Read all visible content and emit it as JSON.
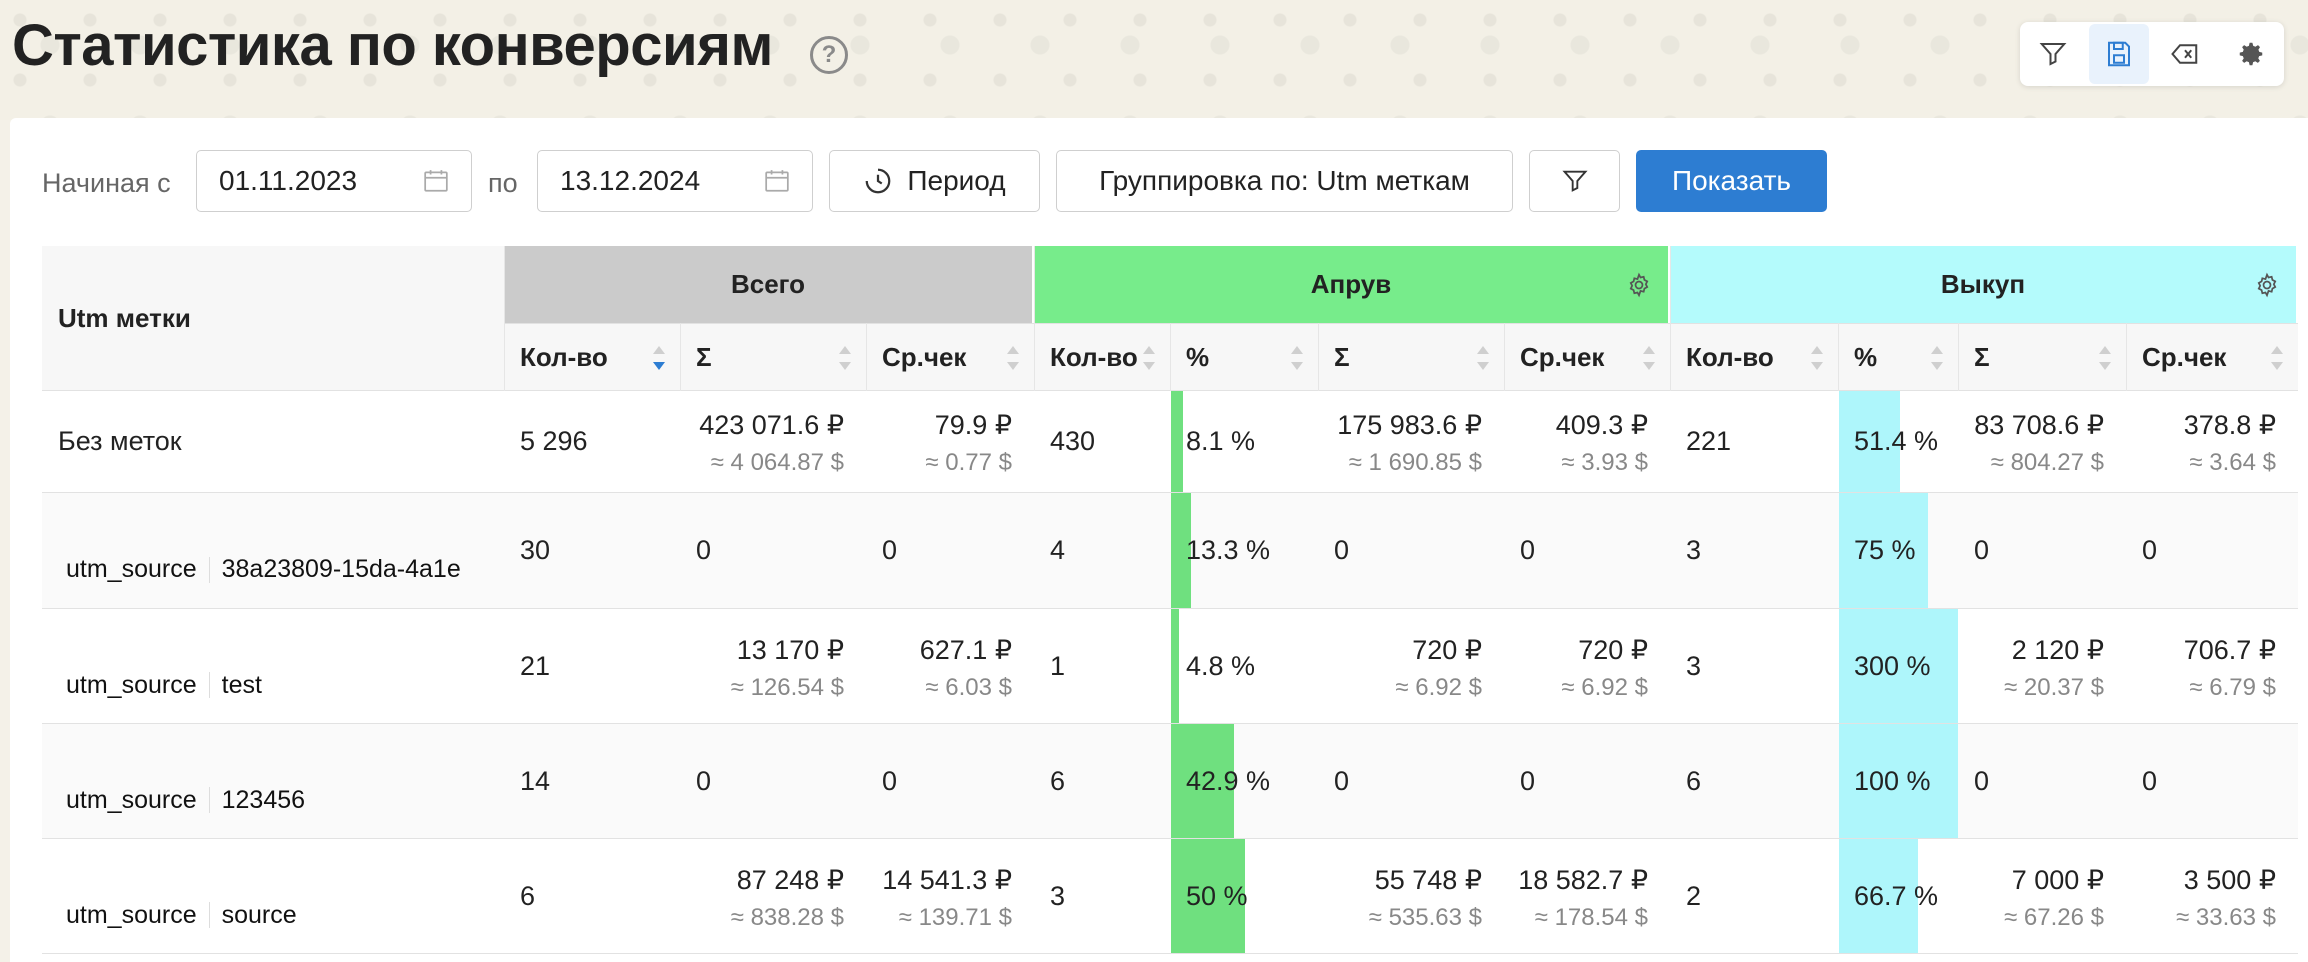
{
  "page": {
    "title": "Статистика по конверсиям"
  },
  "filters": {
    "from_label": "Начиная с",
    "from_date": "01.11.2023",
    "to_label": "по",
    "to_date": "13.12.2024",
    "period_label": "Период",
    "group_label": "Группировка по: Utm меткам",
    "show_label": "Показать"
  },
  "table": {
    "first_col": "Utm метки",
    "groups": [
      "Всего",
      "Апрув",
      "Выкуп"
    ],
    "columns": [
      "Кол-во",
      "Σ",
      "Ср.чек",
      "Кол-во",
      "%",
      "Σ",
      "Ср.чек",
      "Кол-во",
      "%",
      "Σ",
      "Ср.чек"
    ],
    "rows": [
      {
        "tag_key": "",
        "tag_value": "Без меток",
        "total_qty": "5 296",
        "total_sum": "423 071.6 ₽",
        "total_sum_usd": "≈ 4 064.87 $",
        "total_avg": "79.9 ₽",
        "total_avg_usd": "≈ 0.77 $",
        "appr_qty": "430",
        "appr_pct": "8.1 %",
        "appr_pct_val": 8.1,
        "appr_sum": "175 983.6 ₽",
        "appr_sum_usd": "≈ 1 690.85 $",
        "appr_avg": "409.3 ₽",
        "appr_avg_usd": "≈ 3.93 $",
        "buy_qty": "221",
        "buy_pct": "51.4 %",
        "buy_pct_val": 51.4,
        "buy_sum": "83 708.6 ₽",
        "buy_sum_usd": "≈ 804.27 $",
        "buy_avg": "378.8 ₽",
        "buy_avg_usd": "≈ 3.64 $"
      },
      {
        "tag_key": "utm_source",
        "tag_value": "38a23809-15da-4a1e",
        "total_qty": "30",
        "total_sum": "0",
        "total_sum_usd": "",
        "total_avg": "0",
        "total_avg_usd": "",
        "appr_qty": "4",
        "appr_pct": "13.3 %",
        "appr_pct_val": 13.3,
        "appr_sum": "0",
        "appr_sum_usd": "",
        "appr_avg": "0",
        "appr_avg_usd": "",
        "buy_qty": "3",
        "buy_pct": "75 %",
        "buy_pct_val": 75,
        "buy_sum": "0",
        "buy_sum_usd": "",
        "buy_avg": "0",
        "buy_avg_usd": ""
      },
      {
        "tag_key": "utm_source",
        "tag_value": "test",
        "total_qty": "21",
        "total_sum": "13 170 ₽",
        "total_sum_usd": "≈ 126.54 $",
        "total_avg": "627.1 ₽",
        "total_avg_usd": "≈ 6.03 $",
        "appr_qty": "1",
        "appr_pct": "4.8 %",
        "appr_pct_val": 4.8,
        "appr_sum": "720 ₽",
        "appr_sum_usd": "≈ 6.92 $",
        "appr_avg": "720 ₽",
        "appr_avg_usd": "≈ 6.92 $",
        "buy_qty": "3",
        "buy_pct": "300 %",
        "buy_pct_val": 300,
        "buy_sum": "2 120 ₽",
        "buy_sum_usd": "≈ 20.37 $",
        "buy_avg": "706.7 ₽",
        "buy_avg_usd": "≈ 6.79 $"
      },
      {
        "tag_key": "utm_source",
        "tag_value": "123456",
        "total_qty": "14",
        "total_sum": "0",
        "total_sum_usd": "",
        "total_avg": "0",
        "total_avg_usd": "",
        "appr_qty": "6",
        "appr_pct": "42.9 %",
        "appr_pct_val": 42.9,
        "appr_sum": "0",
        "appr_sum_usd": "",
        "appr_avg": "0",
        "appr_avg_usd": "",
        "buy_qty": "6",
        "buy_pct": "100 %",
        "buy_pct_val": 100,
        "buy_sum": "0",
        "buy_sum_usd": "",
        "buy_avg": "0",
        "buy_avg_usd": ""
      },
      {
        "tag_key": "utm_source",
        "tag_value": "source",
        "total_qty": "6",
        "total_sum": "87 248 ₽",
        "total_sum_usd": "≈ 838.28 $",
        "total_avg": "14 541.3 ₽",
        "total_avg_usd": "≈ 139.71 $",
        "appr_qty": "3",
        "appr_pct": "50 %",
        "appr_pct_val": 50,
        "appr_sum": "55 748 ₽",
        "appr_sum_usd": "≈ 535.63 $",
        "appr_avg": "18 582.7 ₽",
        "appr_avg_usd": "≈ 178.54 $",
        "buy_qty": "2",
        "buy_pct": "66.7 %",
        "buy_pct_val": 66.7,
        "buy_sum": "7 000 ₽",
        "buy_sum_usd": "≈ 67.26 $",
        "buy_avg": "3 500 ₽",
        "buy_avg_usd": "≈ 33.63 $"
      }
    ]
  },
  "colors": {
    "approve": "#77ec8b",
    "approve_bar": "#6fe07f",
    "buyout": "#b4fbfc",
    "buyout_bar": "#aef6fb",
    "total": "#cbcbcb",
    "primary": "#2d7dd2"
  },
  "icons": [
    "help-icon",
    "filter-icon",
    "save-icon",
    "clear-icon",
    "settings-icon",
    "calendar-icon",
    "period-icon",
    "gear-icon",
    "sort-icon"
  ]
}
